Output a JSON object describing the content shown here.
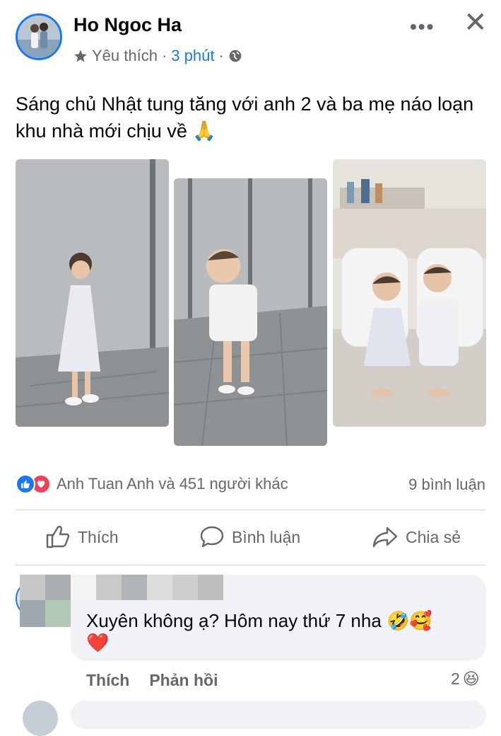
{
  "post": {
    "author": "Ho Ngoc Ha",
    "audience": "Yêu thích",
    "separator": "·",
    "time": "3 phút",
    "more_glyph": "•••",
    "close_glyph": "✕",
    "caption": "Sáng chủ Nhật tung tăng với anh 2 và ba mẹ náo loạn khu nhà mới chịu về",
    "caption_emoji": "🙏"
  },
  "reactions": {
    "summary": "Anh Tuan Anh và 451 người khác",
    "comments": "9 bình luận"
  },
  "actions": {
    "like": "Thích",
    "comment": "Bình luận",
    "share": "Chia sẻ"
  },
  "comment": {
    "text": "Xuyên không ạ? Hôm nay thứ 7 nha",
    "emoji": "🤣🥰",
    "emoji2": "❤️",
    "like_label": "Thích",
    "reply_label": "Phản hồi",
    "reaction_count": "2",
    "reaction_emoji": "😆"
  },
  "colors": {
    "accent": "#1877f2",
    "love": "#f33e58",
    "muted_text": "#65676b",
    "comment_bg": "#f0f2f5"
  }
}
